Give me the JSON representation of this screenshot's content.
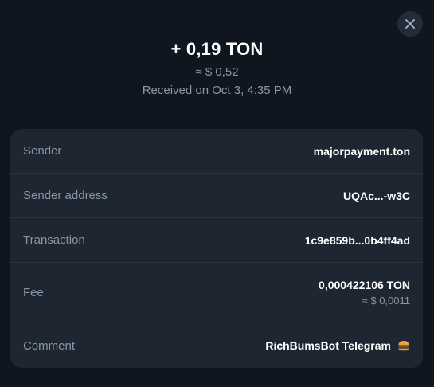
{
  "header": {
    "amount": "+ 0,19 TON",
    "fiat": "≈ $ 0,52",
    "received": "Received on Oct 3, 4:35 PM"
  },
  "close_icon": "close-icon",
  "details": {
    "sender_label": "Sender",
    "sender_value": "majorpayment.ton",
    "address_label": "Sender address",
    "address_value": "UQAc...-w3C",
    "tx_label": "Transaction",
    "tx_value": "1c9e859b...0b4ff4ad",
    "fee_label": "Fee",
    "fee_value": "0,000422106 TON",
    "fee_fiat": "≈ $ 0,0011",
    "comment_label": "Comment",
    "comment_value": "RichBumsBot Telegram",
    "comment_icon": "burger-icon"
  },
  "colors": {
    "background": "#10161f",
    "card": "#1d2631",
    "muted_text": "#8a96a6",
    "divider": "#2a3441"
  }
}
